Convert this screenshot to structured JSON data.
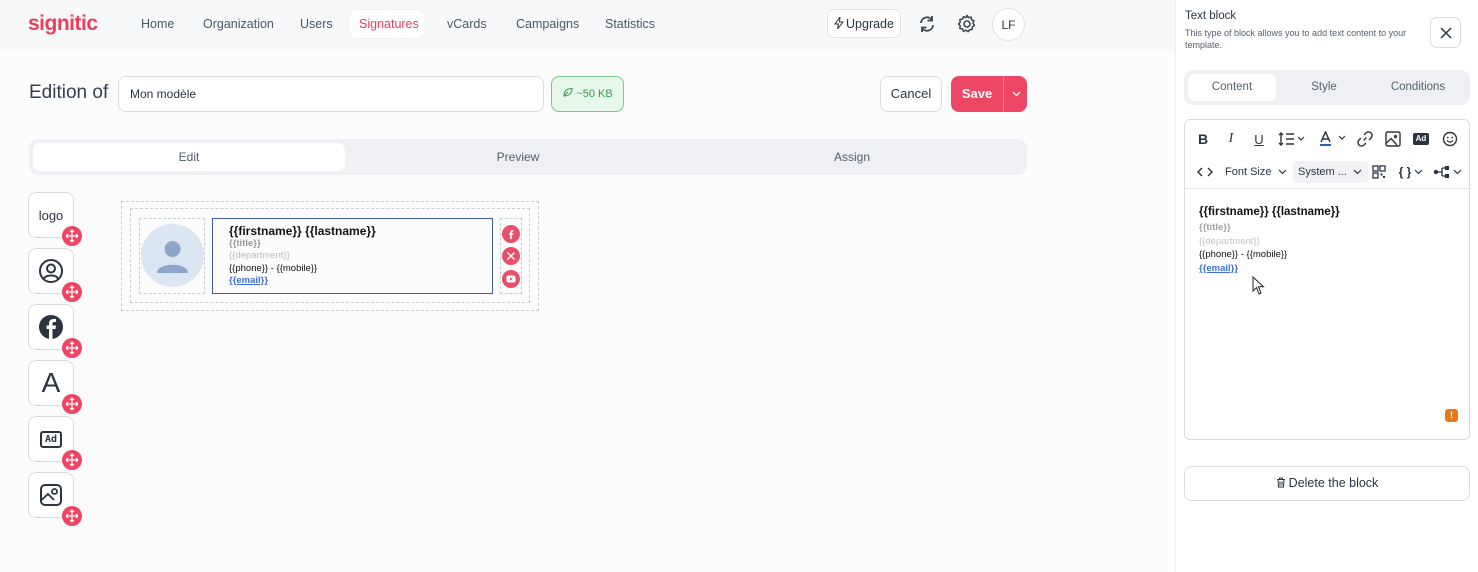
{
  "brand": {
    "logo": "signitic",
    "accent": "#ec4664"
  },
  "nav": {
    "items": [
      {
        "label": "Home"
      },
      {
        "label": "Organization"
      },
      {
        "label": "Users"
      },
      {
        "label": "Signatures",
        "active": true
      },
      {
        "label": "vCards"
      },
      {
        "label": "Campaigns"
      },
      {
        "label": "Statistics"
      }
    ],
    "upgrade_label": "Upgrade",
    "avatar_initials": "LF"
  },
  "edition": {
    "label": "Edition of",
    "template_name": "Mon modèle",
    "size_badge": "~50 KB",
    "cancel_label": "Cancel",
    "save_label": "Save"
  },
  "mode_tabs": [
    "Edit",
    "Preview",
    "Assign"
  ],
  "palette": {
    "items": [
      {
        "label": "logo",
        "icon": "logo-text-icon"
      },
      {
        "icon": "user-circle-icon"
      },
      {
        "icon": "facebook-icon"
      },
      {
        "label": "A",
        "icon": "text-block-icon"
      },
      {
        "label": "Ad",
        "icon": "ad-icon"
      },
      {
        "icon": "image-icon"
      }
    ]
  },
  "signature": {
    "name": "{{firstname}} {{lastname}}",
    "title": "{{title}}",
    "department": "{{department}}",
    "phone_line": "{{phone}} - {{mobile}}",
    "email": "{{email}}",
    "socials": [
      "facebook-icon",
      "x-icon",
      "youtube-icon"
    ]
  },
  "panel": {
    "title": "Text block",
    "description": "This type of block allows you to add text content to your template.",
    "tabs": [
      "Content",
      "Style",
      "Conditions"
    ],
    "toolbar": {
      "font_size_label": "Font Size",
      "font_family_label": "System ...",
      "variables_label": "{ }"
    },
    "delete_label": "Delete the block",
    "warning_glyph": "!"
  }
}
